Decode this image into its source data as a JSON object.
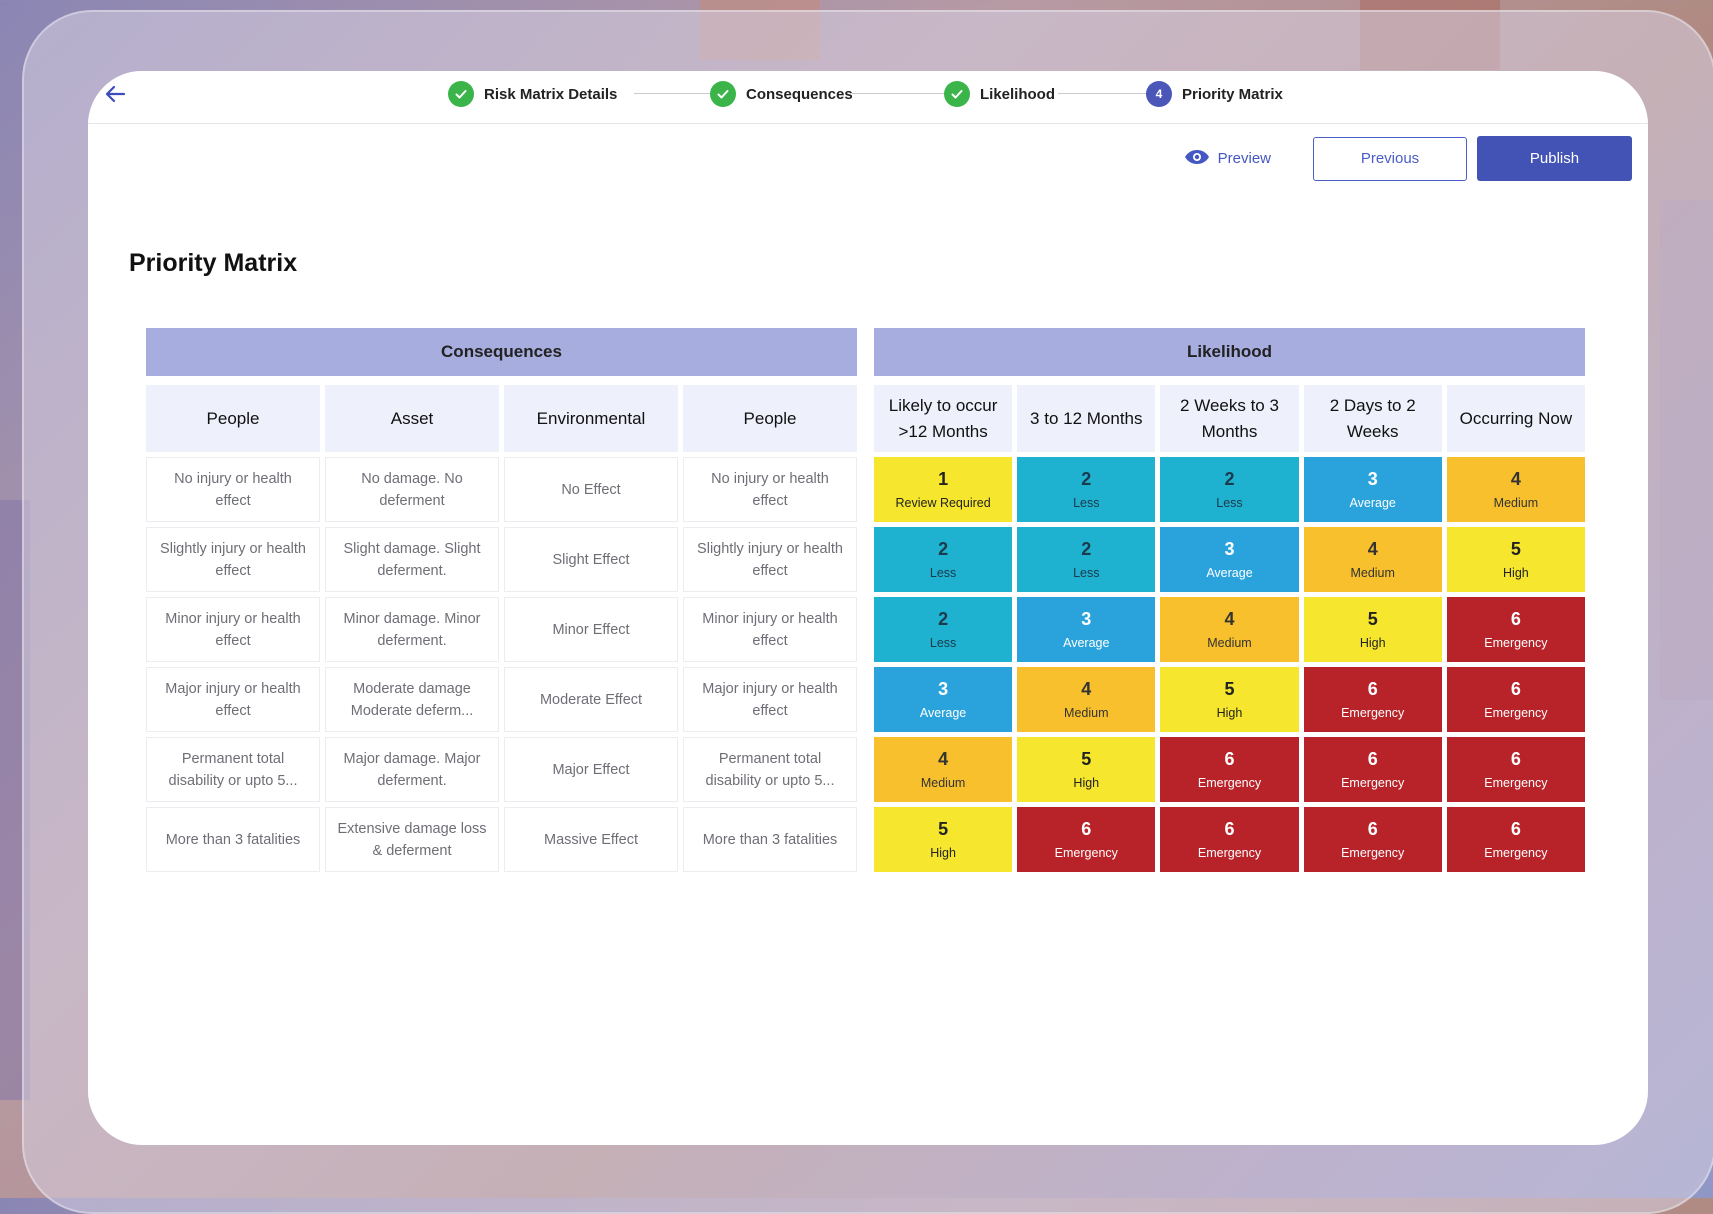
{
  "stepper": {
    "steps": [
      {
        "label": "Risk Matrix Details",
        "state": "done"
      },
      {
        "label": "Consequences",
        "state": "done"
      },
      {
        "label": "Likelihood",
        "state": "done"
      },
      {
        "label": "Priority Matrix",
        "state": "current",
        "number": "4"
      }
    ]
  },
  "actions": {
    "preview_label": "Preview",
    "previous_label": "Previous",
    "publish_label": "Publish"
  },
  "page": {
    "title": "Priority Matrix"
  },
  "consequences": {
    "header": "Consequences",
    "columns": [
      "People",
      "Asset",
      "Environmental",
      "People"
    ],
    "rows": [
      [
        "No injury or health effect",
        "No damage. No deferment",
        "No Effect",
        "No injury or health effect"
      ],
      [
        "Slightly injury or health effect",
        "Slight damage. Slight deferment.",
        "Slight Effect",
        "Slightly injury or health effect"
      ],
      [
        "Minor injury or health effect",
        "Minor damage. Minor deferment.",
        "Minor Effect",
        "Minor injury or health effect"
      ],
      [
        "Major injury or health effect",
        "Moderate damage Moderate deferm...",
        "Moderate Effect",
        "Major injury or health effect"
      ],
      [
        "Permanent total disability or upto 5...",
        "Major damage. Major deferment.",
        "Major Effect",
        "Permanent total disability or upto 5..."
      ],
      [
        "More than 3 fatalities",
        "Extensive damage loss & deferment",
        "Massive Effect",
        "More than 3 fatalities"
      ]
    ]
  },
  "likelihood": {
    "header": "Likelihood",
    "columns": [
      "Likely to occur >12 Months",
      "3 to 12 Months",
      "2 Weeks to 3 Months",
      "2 Days to 2 Weeks",
      "Occurring Now"
    ],
    "rows": [
      [
        {
          "n": "1",
          "l": "Review Required"
        },
        {
          "n": "2",
          "l": "Less"
        },
        {
          "n": "2",
          "l": "Less"
        },
        {
          "n": "3",
          "l": "Average"
        },
        {
          "n": "4",
          "l": "Medium"
        }
      ],
      [
        {
          "n": "2",
          "l": "Less"
        },
        {
          "n": "2",
          "l": "Less"
        },
        {
          "n": "3",
          "l": "Average"
        },
        {
          "n": "4",
          "l": "Medium"
        },
        {
          "n": "5",
          "l": "High"
        }
      ],
      [
        {
          "n": "2",
          "l": "Less"
        },
        {
          "n": "3",
          "l": "Average"
        },
        {
          "n": "4",
          "l": "Medium"
        },
        {
          "n": "5",
          "l": "High"
        },
        {
          "n": "6",
          "l": "Emergency"
        }
      ],
      [
        {
          "n": "3",
          "l": "Average"
        },
        {
          "n": "4",
          "l": "Medium"
        },
        {
          "n": "5",
          "l": "High"
        },
        {
          "n": "6",
          "l": "Emergency"
        },
        {
          "n": "6",
          "l": "Emergency"
        }
      ],
      [
        {
          "n": "4",
          "l": "Medium"
        },
        {
          "n": "5",
          "l": "High"
        },
        {
          "n": "6",
          "l": "Emergency"
        },
        {
          "n": "6",
          "l": "Emergency"
        },
        {
          "n": "6",
          "l": "Emergency"
        }
      ],
      [
        {
          "n": "5",
          "l": "High"
        },
        {
          "n": "6",
          "l": "Emergency"
        },
        {
          "n": "6",
          "l": "Emergency"
        },
        {
          "n": "6",
          "l": "Emergency"
        },
        {
          "n": "6",
          "l": "Emergency"
        }
      ]
    ]
  },
  "level_colors": {
    "1": {
      "bg": "#f6e72e",
      "fg": "#222222"
    },
    "2": {
      "bg": "#1fb1d0",
      "fg": "#1b3a4a"
    },
    "3": {
      "bg": "#2aa3dc",
      "fg": "#ffffff"
    },
    "4": {
      "bg": "#f7c02c",
      "fg": "#333333"
    },
    "5": {
      "bg": "#f6e72e",
      "fg": "#222222"
    },
    "6": {
      "bg": "#b8232a",
      "fg": "#ffffff"
    }
  }
}
